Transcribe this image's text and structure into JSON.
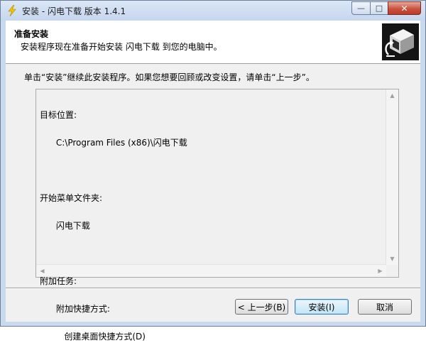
{
  "window": {
    "title": "安装 - 闪电下载 版本 1.4.1",
    "controls": {
      "minimize": "—",
      "maximize": "□",
      "close": "✕"
    }
  },
  "header": {
    "title": "准备安装",
    "subtitle": "安装程序现在准备开始安装 闪电下载 到您的电脑中。"
  },
  "instruction": "单击“安装”继续此安装程序。如果您想要回顾或改变设置，请单击“上一步”。",
  "memo": {
    "lines": [
      "目标位置:",
      "      C:\\Program Files (x86)\\闪电下载",
      "",
      "开始菜单文件夹:",
      "      闪电下载",
      "",
      "附加任务:",
      "      附加快捷方式:",
      "         创建桌面快捷方式(D)"
    ]
  },
  "buttons": {
    "back": "< 上一步(B)",
    "install": "安装(I)",
    "cancel": "取消"
  },
  "colors": {
    "frame": "#c9d9ee",
    "client": "#f0f0f0",
    "default_button_border": "#3c7fb1"
  }
}
